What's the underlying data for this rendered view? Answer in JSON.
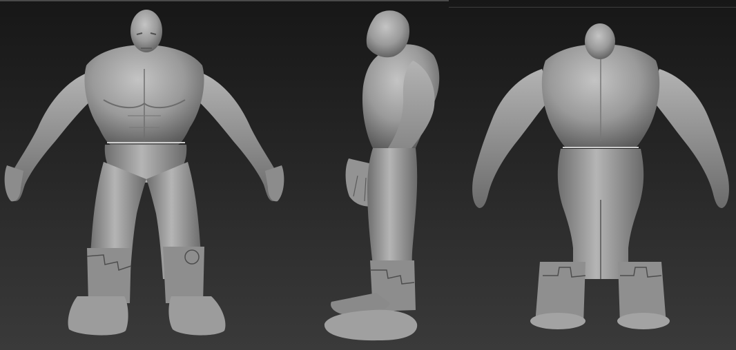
{
  "scene": {
    "views": [
      {
        "id": "front",
        "label": ""
      },
      {
        "id": "side",
        "label": ""
      },
      {
        "id": "back",
        "label": ""
      }
    ],
    "colors": {
      "background_top": "#171717",
      "background_bottom": "#3a3a3a",
      "clay_light": "#b8b8b8",
      "clay_mid": "#8f8f8f",
      "clay_dark": "#5e5e5e"
    }
  }
}
